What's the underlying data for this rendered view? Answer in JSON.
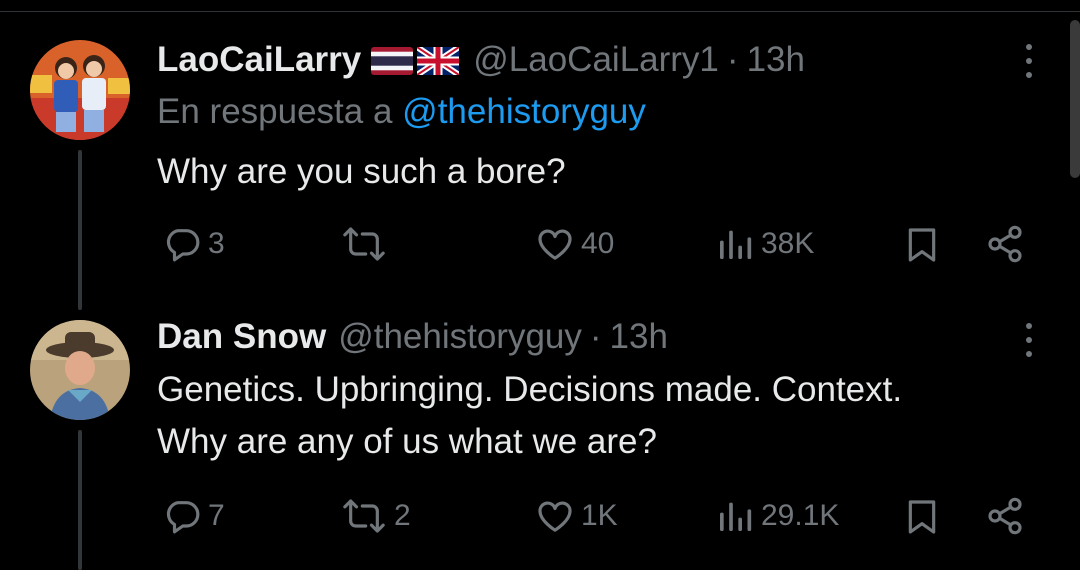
{
  "tweets": [
    {
      "name": "LaoCaiLarry",
      "handle": "@LaoCaiLarry1",
      "time": "13h",
      "reply_prefix": "En respuesta a",
      "reply_mention": "@thehistoryguy",
      "text_lines": [
        "Why are you such a bore?"
      ],
      "actions": {
        "replies": "3",
        "retweets": "",
        "likes": "40",
        "views": "38K"
      },
      "flags": [
        "flag-thailand-icon",
        "flag-uk-icon"
      ]
    },
    {
      "name": "Dan Snow",
      "handle": "@thehistoryguy",
      "time": "13h",
      "text_lines": [
        "Genetics. Upbringing. Decisions made. Context.",
        "Why are any of us what we are?"
      ],
      "actions": {
        "replies": "7",
        "retweets": "2",
        "likes": "1K",
        "views": "29.1K"
      }
    }
  ],
  "separator_dot": "·",
  "colors": {
    "background": "#000000",
    "text": "#e7e9ea",
    "muted": "#71767b",
    "link": "#1d9bf0"
  }
}
